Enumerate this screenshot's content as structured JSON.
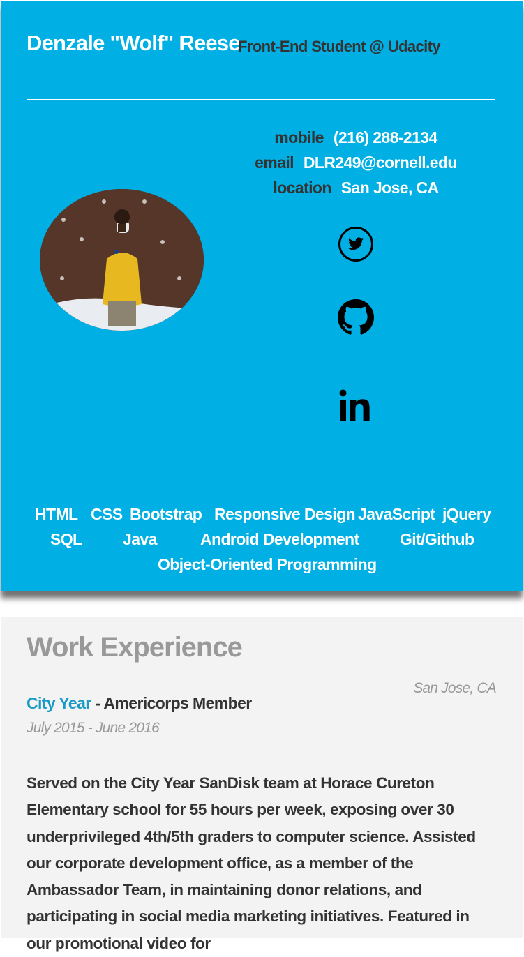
{
  "header": {
    "name": "Denzale \"Wolf\" Reese",
    "role": "Front-End Student @ Udacity"
  },
  "contacts": [
    {
      "key": "mobile",
      "value": "(216) 288-2134"
    },
    {
      "key": "email",
      "value": "DLR249@cornell.edu"
    },
    {
      "key": "location",
      "value": "San Jose, CA"
    }
  ],
  "social": [
    {
      "icon": "twitter-icon"
    },
    {
      "icon": "github-icon"
    },
    {
      "icon": "linkedin-icon"
    }
  ],
  "skills": [
    "HTML",
    "CSS",
    "Bootstrap",
    "Responsive Design",
    "JavaScript",
    "jQuery",
    "SQL",
    "Java",
    "Android Development",
    "Git/Github",
    "Object-Oriented Programming"
  ],
  "work": {
    "section_title": "Work Experience",
    "jobs": [
      {
        "employer": "City Year",
        "position": " - Americorps Member",
        "location": "San Jose, CA",
        "dates": "July 2015 - June 2016",
        "description": "Served on the City Year SanDisk team at Horace Cureton Elementary school for 55 hours per week, exposing over 30 underprivileged 4th/5th graders to computer science. Assisted our corporate development office, as a member of the Ambassador Team, in maintaining donor relations, and participating in social media marketing initiatives. Featured in our promotional video for"
      }
    ]
  },
  "colors": {
    "header_bg": "#00afe3",
    "main_bg": "#f3f3f3",
    "accent_link": "#1a9ac7",
    "dark_text": "#333333",
    "muted_text": "#999999"
  }
}
